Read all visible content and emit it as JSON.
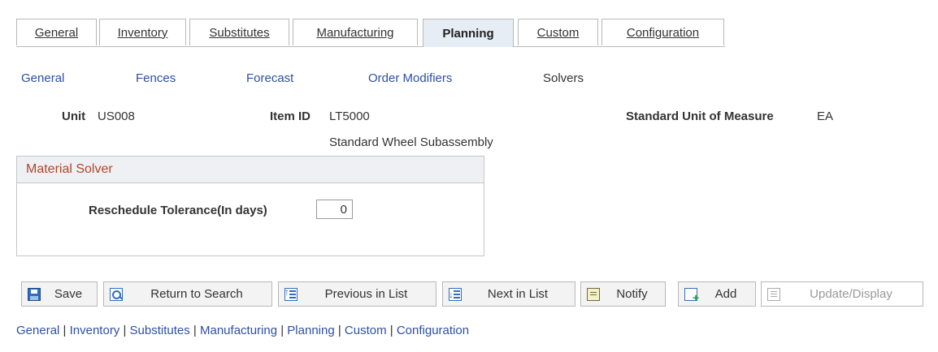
{
  "tabs": [
    {
      "label": "General"
    },
    {
      "label": "Inventory"
    },
    {
      "label": "Substitutes"
    },
    {
      "label": "Manufacturing"
    },
    {
      "label": "Planning"
    },
    {
      "label": "Custom"
    },
    {
      "label": "Configuration"
    }
  ],
  "active_tab": "Planning",
  "subnav": [
    {
      "label": "General"
    },
    {
      "label": "Fences"
    },
    {
      "label": "Forecast"
    },
    {
      "label": "Order Modifiers"
    },
    {
      "label": "Solvers"
    }
  ],
  "header": {
    "unit_label": "Unit",
    "unit_value": "US008",
    "item_label": "Item ID",
    "item_value": "LT5000",
    "item_desc": "Standard Wheel Subassembly",
    "uom_label": "Standard Unit of Measure",
    "uom_value": "EA"
  },
  "material_solver": {
    "title": "Material Solver",
    "reschedule_label": "Reschedule Tolerance(In days)",
    "reschedule_value": "0"
  },
  "toolbar": {
    "save": "Save",
    "return_to_search": "Return to Search",
    "previous_in_list": "Previous in List",
    "next_in_list": "Next in List",
    "notify": "Notify",
    "add": "Add",
    "update_display": "Update/Display"
  },
  "footer_links": [
    "General",
    "Inventory",
    "Substitutes",
    "Manufacturing",
    "Planning",
    "Custom",
    "Configuration"
  ],
  "colors": {
    "link": "#2e50a1",
    "group_title": "#b3452a",
    "active_tab_bg": "#e6edf5"
  }
}
